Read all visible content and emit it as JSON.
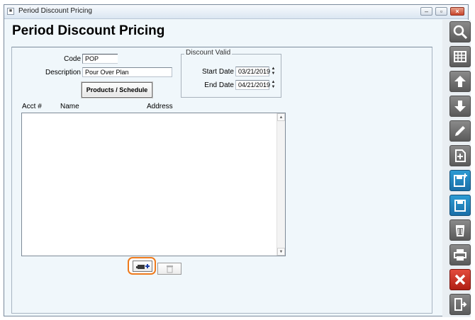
{
  "window": {
    "title": "Period Discount Pricing",
    "controls": [
      "minimize",
      "maximize",
      "close"
    ]
  },
  "page": {
    "title": "Period Discount Pricing"
  },
  "form": {
    "code_label": "Code",
    "code_value": "POP",
    "description_label": "Description",
    "description_value": "Pour Over Plan",
    "products_button": "Products / Schedule"
  },
  "discount_valid": {
    "legend": "Discount Valid",
    "start_label": "Start Date",
    "start_value": "03/21/2019",
    "end_label": "End Date",
    "end_value": "04/21/2019"
  },
  "table": {
    "columns": [
      "Acct #",
      "Name",
      "Address"
    ],
    "rows": []
  },
  "colors": {
    "highlight": "#ee7a1c",
    "accent_blue": "#1a6fa8",
    "danger_red": "#c2271a"
  },
  "sidebar": {
    "buttons": [
      "search-icon",
      "grid-icon",
      "arrow-up-icon",
      "arrow-down-icon",
      "pencil-icon",
      "new-document-icon",
      "save-new-icon",
      "save-icon",
      "trash-icon",
      "print-icon",
      "cancel-icon",
      "exit-icon"
    ]
  }
}
